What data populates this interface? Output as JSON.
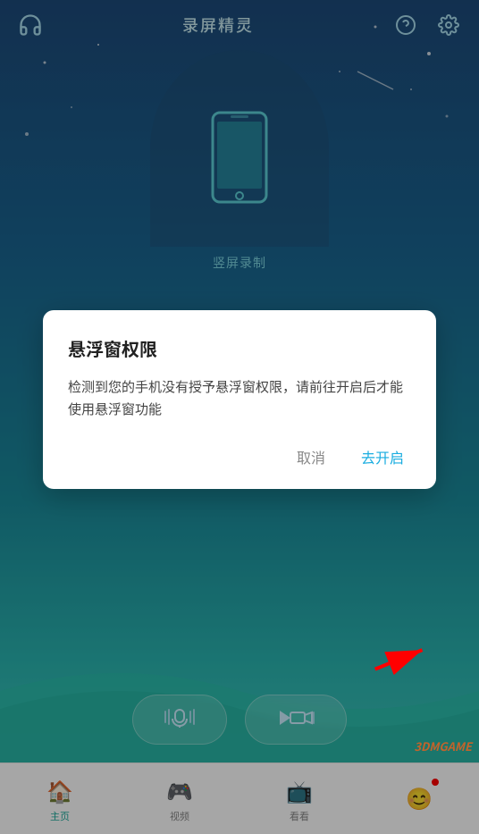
{
  "app": {
    "title": "录屏精灵"
  },
  "header": {
    "left_icon": "headset-icon",
    "title": "录屏精灵",
    "help_icon": "help-circle-icon",
    "settings_icon": "settings-gear-icon"
  },
  "phone_area": {
    "record_label": "竖屏录制"
  },
  "bottom_buttons": [
    {
      "icon": "🎙",
      "label": ""
    },
    {
      "icon": "▶",
      "label": ""
    }
  ],
  "dialog": {
    "title": "悬浮窗权限",
    "body": "检测到您的手机没有授予悬浮窗权限，请前往开启后才能使用悬浮窗功能",
    "cancel_label": "取消",
    "confirm_label": "去开启"
  },
  "navbar": {
    "items": [
      {
        "id": "home",
        "label": "主页",
        "icon": "🏠",
        "active": true
      },
      {
        "id": "video",
        "label": "视频",
        "icon": "🎮",
        "active": false
      },
      {
        "id": "watch",
        "label": "看看",
        "icon": "📺",
        "active": false
      },
      {
        "id": "more",
        "label": "",
        "icon": "😊",
        "active": false
      }
    ]
  },
  "watermark": {
    "text": "3DMGAME"
  }
}
